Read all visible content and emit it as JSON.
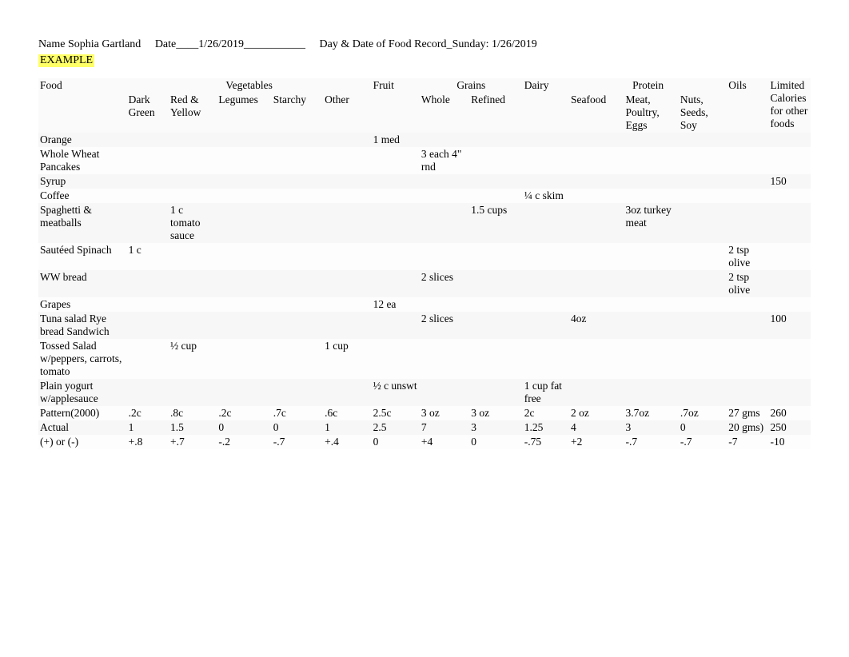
{
  "header": {
    "name_label": "Name",
    "name_value": "Sophia Gartland",
    "date_label": "Date____",
    "date_value": "1/26/2019___________",
    "day_label": "Day & Date of Food Record_",
    "day_value": "Sunday: 1/26/2019",
    "example_label": "EXAMPLE"
  },
  "columns": {
    "food": "Food",
    "vegetables": "Vegetables",
    "fruit": "Fruit",
    "grains": "Grains",
    "dairy": "Dairy",
    "protein": "Protein",
    "oils": "Oils",
    "limited": "Limited Calories for other foods",
    "dark_green": "Dark Green",
    "red_yellow": "Red & Yellow",
    "legumes": "Legumes",
    "starchy": "Starchy",
    "other": "Other",
    "whole": "Whole",
    "refined": "Refined",
    "seafood": "Seafood",
    "meat": "Meat, Poultry, Eggs",
    "nuts": "Nuts, Seeds, Soy"
  },
  "rows": [
    {
      "food": "Orange",
      "dg": "",
      "ry": "",
      "lg": "",
      "st": "",
      "ot": "",
      "fr": "1 med",
      "wh": "",
      "rf": "",
      "da": "",
      "sf": "",
      "mp": "",
      "ns": "",
      "oi": "",
      "lc": ""
    },
    {
      "food": "Whole Wheat Pancakes",
      "dg": "",
      "ry": "",
      "lg": "",
      "st": "",
      "ot": "",
      "fr": "",
      "wh": "3 each 4\" rnd",
      "rf": "",
      "da": "",
      "sf": "",
      "mp": "",
      "ns": "",
      "oi": "",
      "lc": ""
    },
    {
      "food": "Syrup",
      "dg": "",
      "ry": "",
      "lg": "",
      "st": "",
      "ot": "",
      "fr": "",
      "wh": "",
      "rf": "",
      "da": "",
      "sf": "",
      "mp": "",
      "ns": "",
      "oi": "",
      "lc": "150"
    },
    {
      "food": "Coffee",
      "dg": "",
      "ry": "",
      "lg": "",
      "st": "",
      "ot": "",
      "fr": "",
      "wh": "",
      "rf": "",
      "da": "¼ c skim",
      "sf": "",
      "mp": "",
      "ns": "",
      "oi": "",
      "lc": ""
    },
    {
      "food": "Spaghetti & meatballs",
      "dg": "",
      "ry": "1 c tomato sauce",
      "lg": "",
      "st": "",
      "ot": "",
      "fr": "",
      "wh": "",
      "rf": "1.5 cups",
      "da": "",
      "sf": "",
      "mp": "3oz turkey meat",
      "ns": "",
      "oi": "",
      "lc": ""
    },
    {
      "food": "Sautéed Spinach",
      "dg": "1 c",
      "ry": "",
      "lg": "",
      "st": "",
      "ot": "",
      "fr": "",
      "wh": "",
      "rf": "",
      "da": "",
      "sf": "",
      "mp": "",
      "ns": "",
      "oi": "2 tsp olive",
      "lc": ""
    },
    {
      "food": "WW bread",
      "dg": "",
      "ry": "",
      "lg": "",
      "st": "",
      "ot": "",
      "fr": "",
      "wh": "2 slices",
      "rf": "",
      "da": "",
      "sf": "",
      "mp": "",
      "ns": "",
      "oi": "2 tsp olive",
      "lc": ""
    },
    {
      "food": "Grapes",
      "dg": "",
      "ry": "",
      "lg": "",
      "st": "",
      "ot": "",
      "fr": "12 ea",
      "wh": "",
      "rf": "",
      "da": "",
      "sf": "",
      "mp": "",
      "ns": "",
      "oi": "",
      "lc": ""
    },
    {
      "food": "Tuna salad Rye bread Sandwich",
      "dg": "",
      "ry": "",
      "lg": "",
      "st": "",
      "ot": "",
      "fr": "",
      "wh": "2 slices",
      "rf": "",
      "da": "",
      "sf": "4oz",
      "mp": "",
      "ns": "",
      "oi": "",
      "lc": "100"
    },
    {
      "food": "Tossed Salad w/peppers, carrots, tomato",
      "dg": "",
      "ry": "½ cup",
      "lg": "",
      "st": "",
      "ot": "1 cup",
      "fr": "",
      "wh": "",
      "rf": "",
      "da": "",
      "sf": "",
      "mp": "",
      "ns": "",
      "oi": "",
      "lc": ""
    },
    {
      "food": "Plain yogurt w/applesauce",
      "dg": "",
      "ry": "",
      "lg": "",
      "st": "",
      "ot": "",
      "fr": "½ c unswt",
      "wh": "",
      "rf": "",
      "da": "1 cup fat free",
      "sf": "",
      "mp": "",
      "ns": "",
      "oi": "",
      "lc": ""
    },
    {
      "food": "Pattern(2000)",
      "dg": ".2c",
      "ry": ".8c",
      "lg": ".2c",
      "st": ".7c",
      "ot": ".6c",
      "fr": "2.5c",
      "wh": "3 oz",
      "rf": "3 oz",
      "da": "2c",
      "sf": "2 oz",
      "mp": "3.7oz",
      "ns": ".7oz",
      "oi": "27 gms",
      "lc": "260"
    },
    {
      "food": "Actual",
      "dg": "1",
      "ry": "1.5",
      "lg": "0",
      "st": "0",
      "ot": "1",
      "fr": "2.5",
      "wh": "7",
      "rf": "3",
      "da": "1.25",
      "sf": "4",
      "mp": "3",
      "ns": "0",
      "oi": "20 gms)",
      "lc": "250"
    },
    {
      "food": "(+) or (-)",
      "dg": "+.8",
      "ry": "+.7",
      "lg": "-.2",
      "st": "-.7",
      "ot": "+.4",
      "fr": "0",
      "wh": "+4",
      "rf": "0",
      "da": "-.75",
      "sf": "+2",
      "mp": "-.7",
      "ns": "-.7",
      "oi": "-7",
      "lc": "-10"
    }
  ]
}
